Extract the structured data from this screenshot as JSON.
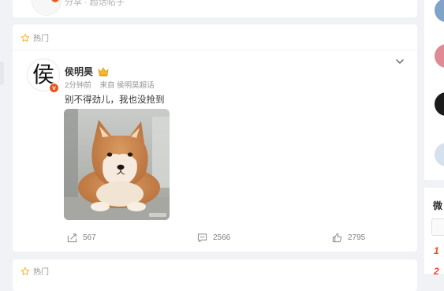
{
  "previous_post": {
    "meta_partial": "分享 · 超话帖子"
  },
  "post": {
    "section_label": "热门",
    "author": {
      "name": "侯明昊",
      "avatar_glyph": "侯",
      "badge": "v"
    },
    "time": "2分钟前",
    "source_prefix": "来自",
    "source": "侯明昊超话",
    "text": "别不得劲儿，我也没抢到",
    "image_alt": "shiba-inu-dog-photo",
    "actions": {
      "forward_count": "567",
      "comment_count": "2566",
      "like_count": "2795"
    }
  },
  "next_post": {
    "section_label": "热门"
  },
  "right_sidebar": {
    "heading_partial": "微",
    "rank_1": "1",
    "rank_2": "2"
  },
  "colors": {
    "page_bg": "#f1f2f5",
    "card_bg": "#ffffff",
    "accent_orange": "#e9561c",
    "star": "#f5b33c",
    "rank_red": "#f2422f"
  }
}
